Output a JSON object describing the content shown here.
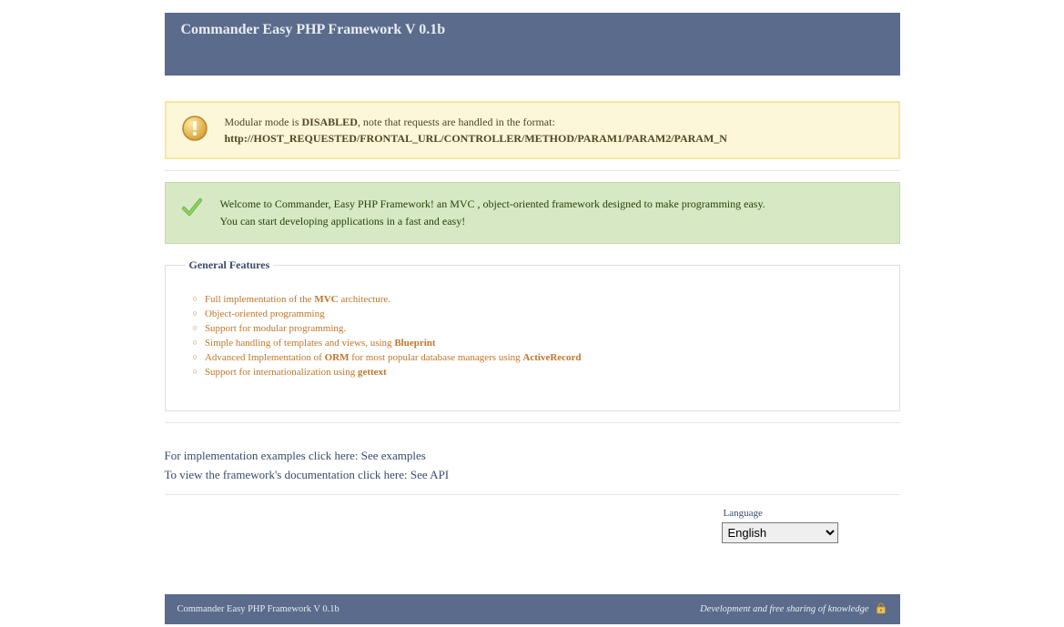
{
  "header": {
    "title": "Commander Easy PHP Framework V 0.1b"
  },
  "notice": {
    "text_prefix": "Modular mode is ",
    "bold": "DISABLED",
    "text_suffix": ", note that requests are handled in the format:",
    "url_format": "http://HOST_REQUESTED/FRONTAL_URL/CONTROLLER/METHOD/PARAM1/PARAM2/PARAM_N"
  },
  "welcome": {
    "line1": "Welcome to Commander, Easy PHP Framework! an MVC , object-oriented framework designed to make programming easy.",
    "line2": "You can start developing applications in a fast and easy!"
  },
  "features": {
    "legend": "General Features",
    "items": [
      {
        "pre": "Full implementation of the ",
        "bold": "MVC",
        "post": " architecture."
      },
      {
        "pre": "Object-oriented programming",
        "bold": "",
        "post": ""
      },
      {
        "pre": "Support for modular programming.",
        "bold": "",
        "post": ""
      },
      {
        "pre": "Simple handling of templates and views, using ",
        "bold": "Blueprint",
        "post": ""
      },
      {
        "pre": "Advanced Implementation of ",
        "bold": "ORM",
        "post": " for most popular database managers using ",
        "bold2": "ActiveRecord"
      },
      {
        "pre": "Support for internationalization using ",
        "bold": "gettext",
        "post": ""
      }
    ]
  },
  "links": {
    "examples_text": "For implementation examples click here: ",
    "examples_link": "See examples",
    "api_text": "To view the framework's documentation click here:  ",
    "api_link": "See API"
  },
  "language": {
    "label": "Language",
    "options": [
      "English"
    ],
    "selected": "English"
  },
  "footer": {
    "left": "Commander Easy PHP Framework V 0.1b",
    "right": "Development and free sharing of knowledge"
  }
}
